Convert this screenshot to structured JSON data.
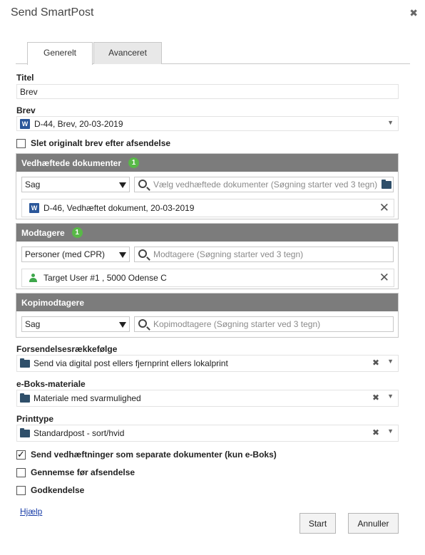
{
  "dialog": {
    "title": "Send SmartPost",
    "close_glyph": "✖"
  },
  "tabs": [
    {
      "label": "Generelt",
      "active": true
    },
    {
      "label": "Avanceret",
      "active": false
    }
  ],
  "titel": {
    "label": "Titel",
    "value": "Brev"
  },
  "brev": {
    "label": "Brev",
    "value": "D-44, Brev, 20-03-2019",
    "icon": "word-icon"
  },
  "slet_original": {
    "label": "Slet originalt brev efter afsendelse",
    "checked": false
  },
  "vedhaeftede": {
    "header": "Vedhæftede dokumenter",
    "count": "1",
    "select_value": "Sag",
    "search_placeholder": "Vælg vedhæftede dokumenter (Søgning starter ved 3 tegn)",
    "items": [
      {
        "label": "D-46, Vedhæftet dokument, 20-03-2019",
        "icon": "word-icon"
      }
    ]
  },
  "modtagere": {
    "header": "Modtagere",
    "count": "1",
    "select_value": "Personer (med CPR)",
    "search_placeholder": "Modtagere (Søgning starter ved 3 tegn)",
    "items": [
      {
        "label": "Target User #1 , 5000 Odense C",
        "icon": "person-icon"
      }
    ]
  },
  "kopimodtagere": {
    "header": "Kopimodtagere",
    "select_value": "Sag",
    "search_placeholder": "Kopimodtagere (Søgning starter ved 3 tegn)"
  },
  "forsendelse": {
    "label": "Forsendelsesrækkefølge",
    "value": "Send via digital post ellers fjernprint ellers lokalprint"
  },
  "eboks": {
    "label": "e-Boks-materiale",
    "value": "Materiale med svarmulighed"
  },
  "printtype": {
    "label": "Printtype",
    "value": "Standardpost - sort/hvid"
  },
  "options": {
    "separate": {
      "label": "Send vedhæftninger som separate dokumenter (kun e-Boks)",
      "checked": true
    },
    "gennemse": {
      "label": "Gennemse før afsendelse",
      "checked": false
    },
    "godkendelse": {
      "label": "Godkendelse",
      "checked": false
    }
  },
  "footer": {
    "help": "Hjælp",
    "start": "Start",
    "cancel": "Annuller"
  },
  "colors": {
    "section_header": "#7c7c7c",
    "badge": "#58b947",
    "word": "#2b579a",
    "link": "#1a3ea8"
  }
}
